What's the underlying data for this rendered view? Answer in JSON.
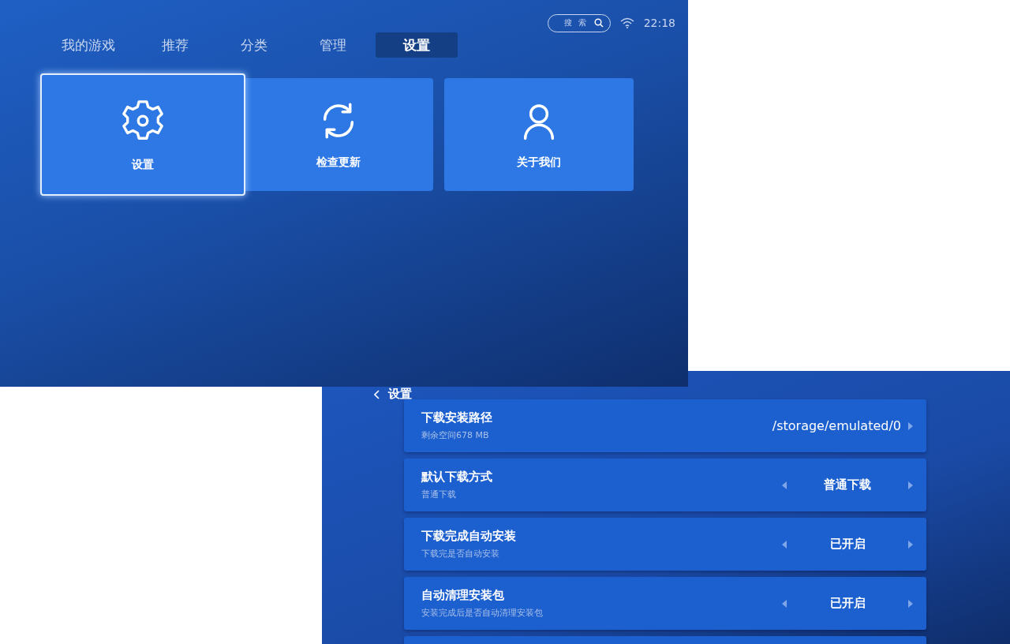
{
  "home_screen": {
    "search": {
      "placeholder": "搜 索"
    },
    "time": "22:18",
    "tabs": [
      {
        "label": "我的游戏",
        "selected": false
      },
      {
        "label": "推荐",
        "selected": false
      },
      {
        "label": "分类",
        "selected": false
      },
      {
        "label": "管理",
        "selected": false
      },
      {
        "label": "设置",
        "selected": true
      }
    ],
    "tiles": [
      {
        "label": "设置",
        "kind": "gear",
        "selected": true
      },
      {
        "label": "检查更新",
        "kind": "refresh",
        "selected": false
      },
      {
        "label": "关于我们",
        "kind": "person",
        "selected": false
      }
    ]
  },
  "settings_screen": {
    "back_label": "设置",
    "rows": [
      {
        "kind": "path",
        "title": "下载安装路径",
        "subtitle": "剩余空间678 MB",
        "value": "/storage/emulated/0"
      },
      {
        "kind": "choice",
        "title": "默认下载方式",
        "subtitle": "普通下载",
        "value": "普通下载"
      },
      {
        "kind": "choice",
        "title": "下载完成自动安装",
        "subtitle": "下载完是否自动安装",
        "value": "已开启"
      },
      {
        "kind": "choice",
        "title": "自动清理安装包",
        "subtitle": "安装完成后是否自动清理安装包",
        "value": "已开启"
      }
    ]
  }
}
